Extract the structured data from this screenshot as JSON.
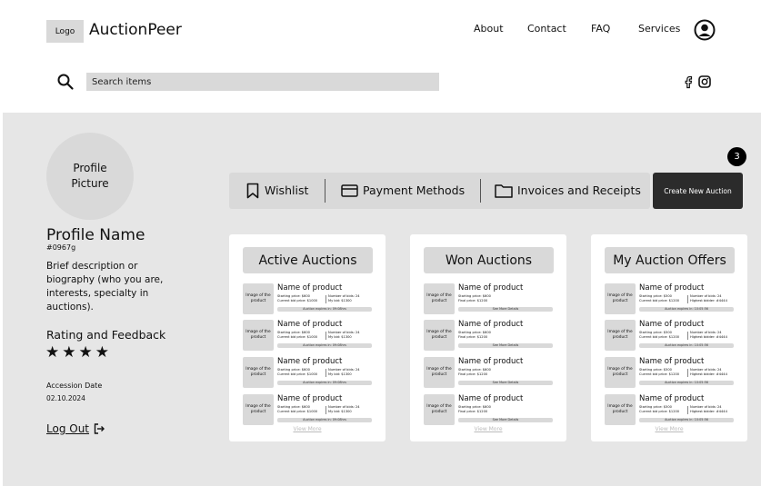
{
  "header": {
    "logo_label": "Logo",
    "brand": "AuctionPeer",
    "nav": [
      {
        "label": "About"
      },
      {
        "label": "Contact"
      },
      {
        "label": "FAQ"
      },
      {
        "label": "Services"
      }
    ],
    "user_icon": "user-circle-icon"
  },
  "search": {
    "placeholder": "Search items",
    "icon": "search-icon"
  },
  "social": {
    "facebook_icon": "facebook-icon",
    "instagram_icon": "instagram-icon"
  },
  "profile": {
    "picture_label": "Profile Picture",
    "name": "Profile Name",
    "id": "#0967g",
    "bio": "Brief description or biography (who you are, interests, specialty in auctions).",
    "rating_title": "Rating and Feedback",
    "stars": 4,
    "stars_text": "★★★★",
    "accession_label": "Accession Date",
    "accession_date": "02.10.2024",
    "logout_label": "Log Out"
  },
  "tabs": [
    {
      "label": "Wishlist",
      "icon": "bookmark-icon"
    },
    {
      "label": "Payment Methods",
      "icon": "credit-card-icon"
    },
    {
      "label": "Invoices and Receipts",
      "icon": "folder-icon"
    }
  ],
  "new_auction_label": "Create New Auction",
  "notification_count": "3",
  "cards": {
    "active": {
      "title": "Active Auctions",
      "view_more": "View More",
      "items": [
        {
          "image": "Image of the product",
          "name": "Name of product",
          "l1": "Starting price: $600",
          "l2": "Current bid price: $1000",
          "r1": "Number of bids: 24",
          "r2": "My bid: $1300",
          "bar": "Auction expires in: 09:08hrs"
        },
        {
          "image": "Image of the product",
          "name": "Name of product",
          "l1": "Starting price: $600",
          "l2": "Current bid price: $1000",
          "r1": "Number of bids: 24",
          "r2": "My bid: $1300",
          "bar": "Auction expires in: 09:08hrs"
        },
        {
          "image": "Image of the product",
          "name": "Name of product",
          "l1": "Starting price: $600",
          "l2": "Current bid price: $1000",
          "r1": "Number of bids: 24",
          "r2": "My bid: $1300",
          "bar": "Auction expires in: 09:08hrs"
        },
        {
          "image": "Image of the product",
          "name": "Name of product",
          "l1": "Starting price: $600",
          "l2": "Current bid price: $1000",
          "r1": "Number of bids: 24",
          "r2": "My bid: $1300",
          "bar": "Auction expires in: 09:08hrs"
        }
      ]
    },
    "won": {
      "title": "Won Auctions",
      "view_more": "View More",
      "items": [
        {
          "image": "Image of the product",
          "name": "Name of product",
          "l1": "Starting price: $600",
          "l2": "Final price: $1200",
          "bar": "See More Details"
        },
        {
          "image": "Image of the product",
          "name": "Name of product",
          "l1": "Starting price: $600",
          "l2": "Final price: $1200",
          "bar": "See More Details"
        },
        {
          "image": "Image of the product",
          "name": "Name of product",
          "l1": "Starting price: $600",
          "l2": "Final price: $1200",
          "bar": "See More Details"
        },
        {
          "image": "Image of the product",
          "name": "Name of product",
          "l1": "Starting price: $600",
          "l2": "Final price: $1200",
          "bar": "See More Details"
        }
      ]
    },
    "offers": {
      "title": "My Auction Offers",
      "view_more": "View More",
      "items": [
        {
          "image": "Image of the product",
          "name": "Name of product",
          "l1": "Starting price: $500",
          "l2": "Current bid price: $1200",
          "r1": "Number of bids: 24",
          "r2": "Highest bidder: #4444",
          "bar": "Auction expires in: 10:05:56"
        },
        {
          "image": "Image of the product",
          "name": "Name of product",
          "l1": "Starting price: $500",
          "l2": "Current bid price: $1200",
          "r1": "Number of bids: 24",
          "r2": "Highest bidder: #4444",
          "bar": "Auction expires in: 10:05:56"
        },
        {
          "image": "Image of the product",
          "name": "Name of product",
          "l1": "Starting price: $500",
          "l2": "Current bid price: $1200",
          "r1": "Number of bids: 24",
          "r2": "Highest bidder: #4444",
          "bar": "Auction expires in: 10:05:56"
        },
        {
          "image": "Image of the product",
          "name": "Name of product",
          "l1": "Starting price: $500",
          "l2": "Current bid price: $1200",
          "r1": "Number of bids: 24",
          "r2": "Highest bidder: #4444",
          "bar": "Auction expires in: 10:05:56"
        }
      ]
    }
  }
}
